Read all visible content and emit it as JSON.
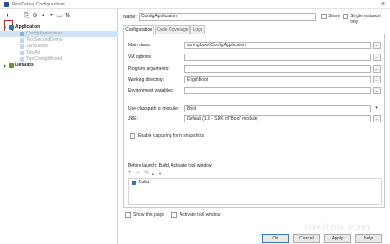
{
  "window": {
    "title": "Run/Debug Configurations"
  },
  "toolbar": {
    "add": "+",
    "remove": "−",
    "copy": "⎘",
    "settings": "⚙",
    "up": "▲",
    "down": "▼",
    "folder": "▭",
    "sort": "⇅"
  },
  "tree": {
    "group_application": "Application",
    "items": [
      "ConfigApplication",
      "TestSecondDemo",
      "JunitDemo",
      "TestAll",
      "TestConfigWizard"
    ],
    "group_defaults": "Defaults"
  },
  "form": {
    "name_label": "Name:",
    "name_value": "ConfigApplication",
    "share_label": "Share",
    "single_instance_label": "Single instance only",
    "tabs": [
      "Configuration",
      "Code Coverage",
      "Logs"
    ],
    "main_class_label": "Main class:",
    "main_class_value": "spring.boot.ConfigApplication",
    "vm_options_label": "VM options:",
    "program_args_label": "Program arguments:",
    "working_dir_label": "Working directory:",
    "working_dir_value": "E:\\git\\Boot",
    "env_vars_label": "Environment variables:",
    "classpath_label": "Use classpath of module:",
    "classpath_value": "Boot",
    "jre_label": "JRE:",
    "jre_value": "Default (1.8 - SDK of 'Boot' module)",
    "provided_scope_label": "Enable capturing form snapshots",
    "dots": "...",
    "dropdown": "▾"
  },
  "before_launch": {
    "title": "Before launch: Build, Activate tool window",
    "add": "+",
    "remove": "−",
    "edit": "✎",
    "up": "▲",
    "down": "▼",
    "items": [
      "Build"
    ]
  },
  "bottom": {
    "show_page_label": "Show this page",
    "activate_tool_label": "Activate tool window"
  },
  "footer": {
    "ok": "OK",
    "cancel": "Cancel",
    "apply": "Apply",
    "help": "Help"
  },
  "watermark": "tuxitoo.com"
}
